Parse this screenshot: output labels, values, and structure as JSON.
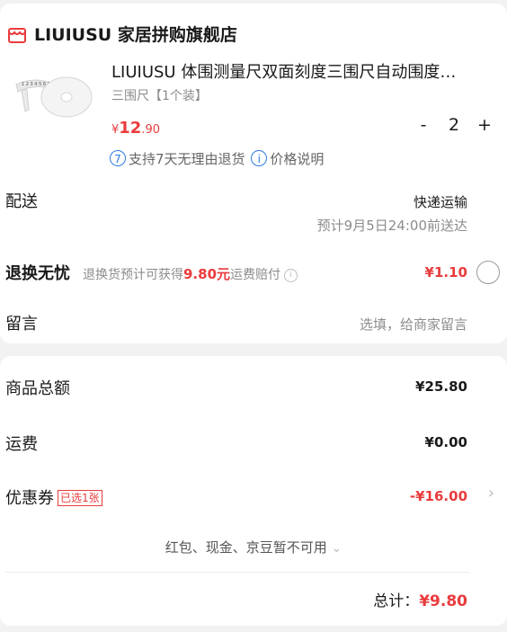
{
  "store": {
    "name": "LIUIUSU 家居拼购旗舰店"
  },
  "product": {
    "title": "LIUIUSU 体围测量尺双面刻度三围尺自动围度…",
    "spec": "三围尺【1个装】",
    "price_symbol": "¥",
    "price_int": "12",
    "price_dec": ".90",
    "qty_minus": "-",
    "quantity": "2",
    "qty_plus": "+",
    "return_badge": "7",
    "return_text": "支持7天无理由退货",
    "info_badge": "i",
    "price_note": "价格说明"
  },
  "delivery": {
    "label": "配送",
    "method": "快递运输",
    "eta": "预计9月5日24:00前送达"
  },
  "return_insurance": {
    "label": "退换无忧",
    "desc_prefix": "退换货预计可获得",
    "amount": "9.80元",
    "desc_suffix": "运费赔付",
    "info_badge": "i",
    "price": "¥1.10"
  },
  "message": {
    "label": "留言",
    "placeholder": "选填，给商家留言"
  },
  "summary": {
    "subtotal_label": "商品总额",
    "subtotal_value": "¥25.80",
    "shipping_label": "运费",
    "shipping_value": "¥0.00",
    "coupon_label": "优惠券",
    "coupon_badge": "已选1张",
    "coupon_value": "-¥16.00",
    "coupon_chevron": "›",
    "unavailable_text": "红包、现金、京豆暂不可用",
    "unavailable_chevron": "⌄",
    "total_label": "总计：",
    "total_value": "¥9.80"
  },
  "colors": {
    "accent": "#e93b3d",
    "link_blue": "#2a7be0",
    "background": "#f2f2f2"
  },
  "icons": [
    "store-icon",
    "tape-measure-thumbnail",
    "seven-day-return-icon",
    "info-icon",
    "chevron-right-icon",
    "chevron-down-icon",
    "radio-unchecked-icon"
  ]
}
